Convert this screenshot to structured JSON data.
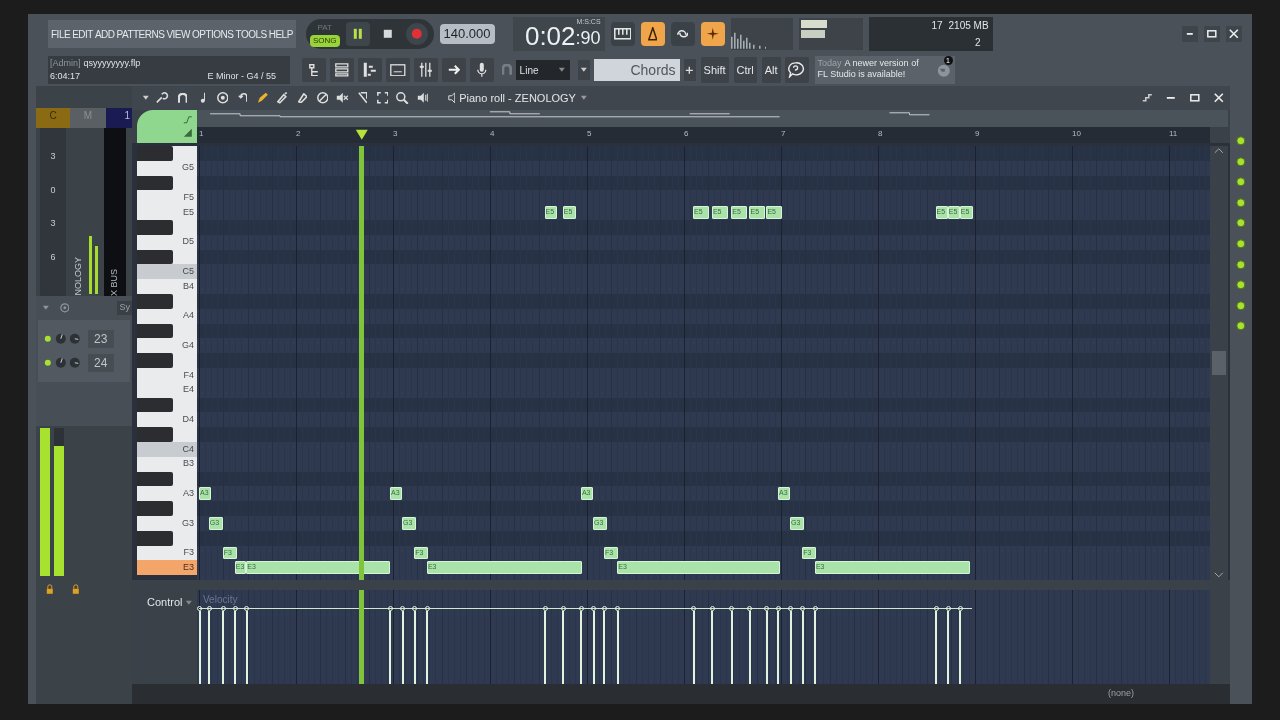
{
  "menu": [
    "FILE",
    "EDIT",
    "ADD",
    "PATTERNS",
    "VIEW",
    "OPTIONS",
    "TOOLS",
    "HELP"
  ],
  "modes": [
    {
      "label": "PAT",
      "selected": false
    },
    {
      "label": "SONG",
      "selected": true
    }
  ],
  "tempo": "140.000",
  "time": {
    "unit": "M:S:CS",
    "value": "0:02",
    "sub": ":90"
  },
  "monitor": {
    "voices": "17",
    "memory": "2105 MB",
    "cpu": "2"
  },
  "hint": {
    "user": "[Admin]",
    "file": "qsyyyyyyyy.flp",
    "elapsed": "6:04:17",
    "scale": "E Minor - G4 / 55"
  },
  "snap": "Line",
  "chords": "Chords",
  "modifiers": [
    "Shift",
    "Ctrl",
    "Alt"
  ],
  "news": {
    "date": "Today",
    "text": "A newer version of FL Studio is available!",
    "badge": "1"
  },
  "mixer": {
    "headers": [
      "C",
      "M",
      "1"
    ],
    "scale": [
      "3",
      "0",
      "3",
      "6"
    ],
    "track_name": "NOLOGY",
    "bus_name": "X BUS",
    "tab": "Sy",
    "slots": [
      "23",
      "24"
    ],
    "meters": [
      {
        "level": 1.0
      },
      {
        "level": 0.88
      }
    ]
  },
  "piano_roll": {
    "title": "Piano roll - ZENOLOGY",
    "bars": [
      "1",
      "2",
      "3",
      "4",
      "5",
      "6",
      "7",
      "8",
      "9",
      "10",
      "11"
    ],
    "keys": [
      {
        "kind": "black"
      },
      {
        "kind": "white",
        "label": "G5",
        "selected": false
      },
      {
        "kind": "black"
      },
      {
        "kind": "white",
        "label": "F5",
        "selected": false
      },
      {
        "kind": "white",
        "label": "E5",
        "selected": false,
        "notes": [
          {
            "label": "E5"
          },
          {
            "label": "E5"
          },
          {
            "label": "E5"
          },
          {
            "label": "E5"
          },
          {
            "label": "E5"
          },
          {
            "label": "E5"
          },
          {
            "label": "E5"
          },
          {
            "label": "E5"
          },
          {
            "label": "E5"
          },
          {
            "label": "E5"
          }
        ]
      },
      {
        "kind": "black"
      },
      {
        "kind": "white",
        "label": "D5",
        "selected": false
      },
      {
        "kind": "black"
      },
      {
        "kind": "c",
        "label": "C5",
        "selected": false
      },
      {
        "kind": "white",
        "label": "B4",
        "selected": false
      },
      {
        "kind": "black"
      },
      {
        "kind": "white",
        "label": "A4",
        "selected": false
      },
      {
        "kind": "black"
      },
      {
        "kind": "white",
        "label": "G4",
        "selected": false
      },
      {
        "kind": "black"
      },
      {
        "kind": "white",
        "label": "F4",
        "selected": false
      },
      {
        "kind": "white",
        "label": "E4",
        "selected": false
      },
      {
        "kind": "black"
      },
      {
        "kind": "white",
        "label": "D4",
        "selected": false
      },
      {
        "kind": "black"
      },
      {
        "kind": "c",
        "label": "C4",
        "selected": false
      },
      {
        "kind": "white",
        "label": "B3",
        "selected": false
      },
      {
        "kind": "black"
      },
      {
        "kind": "white",
        "label": "A3",
        "selected": false,
        "notes": [
          {
            "label": "A3"
          },
          {
            "label": "A3"
          },
          {
            "label": "A3"
          },
          {
            "label": "A3"
          }
        ]
      },
      {
        "kind": "black"
      },
      {
        "kind": "white",
        "label": "G3",
        "selected": false,
        "notes": [
          {
            "label": "G3"
          },
          {
            "label": "G3"
          },
          {
            "label": "G3"
          },
          {
            "label": "G3"
          }
        ]
      },
      {
        "kind": "black"
      },
      {
        "kind": "white",
        "label": "F3",
        "selected": false,
        "notes": [
          {
            "label": "F3"
          },
          {
            "label": "F3"
          },
          {
            "label": "F3"
          },
          {
            "label": "F3"
          }
        ]
      },
      {
        "kind": "white",
        "label": "E3",
        "selected": true,
        "notes": [
          {
            "label": "E3"
          },
          {
            "label": "E3"
          },
          {
            "label": "E3"
          },
          {
            "label": "E3"
          },
          {
            "label": "E3"
          }
        ]
      }
    ],
    "control": {
      "label": "Control",
      "parameter": "Velocity"
    }
  },
  "footer": {
    "channel": "(none)"
  }
}
